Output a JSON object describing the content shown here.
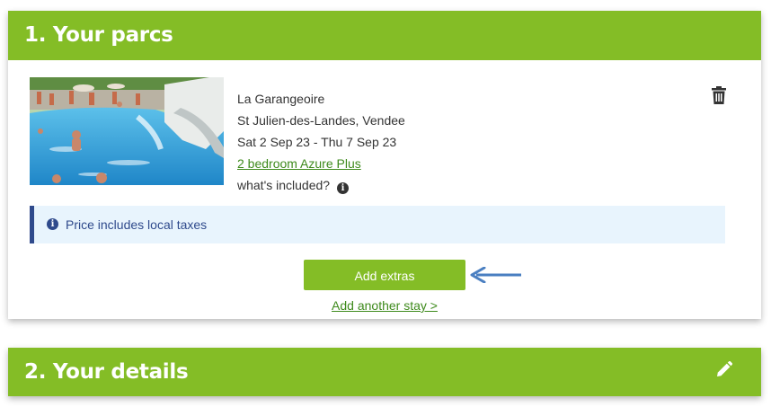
{
  "colors": {
    "brand_green": "#84bd26",
    "link_green": "#3e8a1c",
    "notice_bg": "#e8f4fd",
    "notice_accent": "#2f4a8c",
    "arrow": "#4a7fc1"
  },
  "section1": {
    "title": "1. Your parcs",
    "booking": {
      "parc_name": "La Garangeoire",
      "location": "St Julien-des-Landes, Vendee",
      "dates": "Sat 2 Sep 23 - Thu 7 Sep 23",
      "accommodation": "2 bedroom Azure Plus",
      "included_label": "what's included?",
      "info_icon": "info-circle-icon",
      "delete_icon": "trash-icon"
    },
    "notice": {
      "icon": "info-circle-icon",
      "text": "Price includes local taxes"
    },
    "add_extras_label": "Add extras",
    "add_another_stay_label": "Add another stay >"
  },
  "section2": {
    "title": "2. Your details",
    "edit_icon": "pencil-icon"
  }
}
